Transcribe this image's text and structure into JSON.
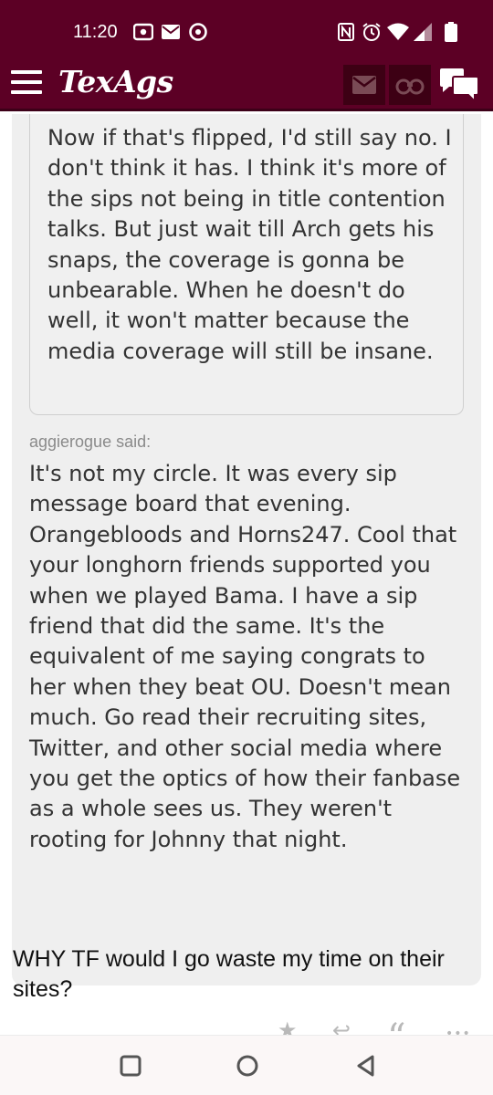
{
  "status_bar": {
    "time": "11:20",
    "left_icons": [
      "cast-icon",
      "mail-icon",
      "chrome-icon"
    ],
    "right_icons": [
      "nfc-icon",
      "alarm-icon",
      "wifi-icon",
      "signal-icon",
      "battery-icon"
    ]
  },
  "header": {
    "logo": "TexAgs",
    "icons": [
      "mail-icon",
      "binoculars-icon",
      "chat-icon"
    ]
  },
  "thread": {
    "nested_quote_text": "Now if that's flipped, I'd still say no. I don't think it has. I think it's more of the sips not being in title contention talks. But just wait till Arch gets his snaps, the coverage is gonna be unbearable. When he doesn't do well, it won't matter because the media coverage will still be insane.",
    "quote_attribution": "aggierogue said:",
    "quote_text": "It's not my circle. It was every sip message board that evening. Orangebloods and Horns247. Cool that your longhorn friends supported you when we played Bama. I have a sip friend that did the same. It's the equivalent of me saying congrats to her when they beat OU. Doesn't mean much. Go read their recruiting sites, Twitter, and other social media where you get the optics of how their fanbase as a whole sees us. They weren't rooting for Johnny that night.",
    "reply_text": "WHY TF would I go waste my time on their sites?"
  },
  "post_actions": [
    {
      "name": "star-icon",
      "glyph": "★"
    },
    {
      "name": "reply-icon",
      "glyph": "↩"
    },
    {
      "name": "quote-icon",
      "glyph": "“"
    },
    {
      "name": "more-icon",
      "glyph": "•••"
    }
  ],
  "nav_bar": {
    "buttons": [
      "recents-button",
      "home-button",
      "back-button"
    ]
  },
  "colors": {
    "brand": "#5c0025",
    "brand_dark": "#3d0014",
    "quote_bg": "#efefef",
    "muted_text": "#8a8a8a"
  }
}
